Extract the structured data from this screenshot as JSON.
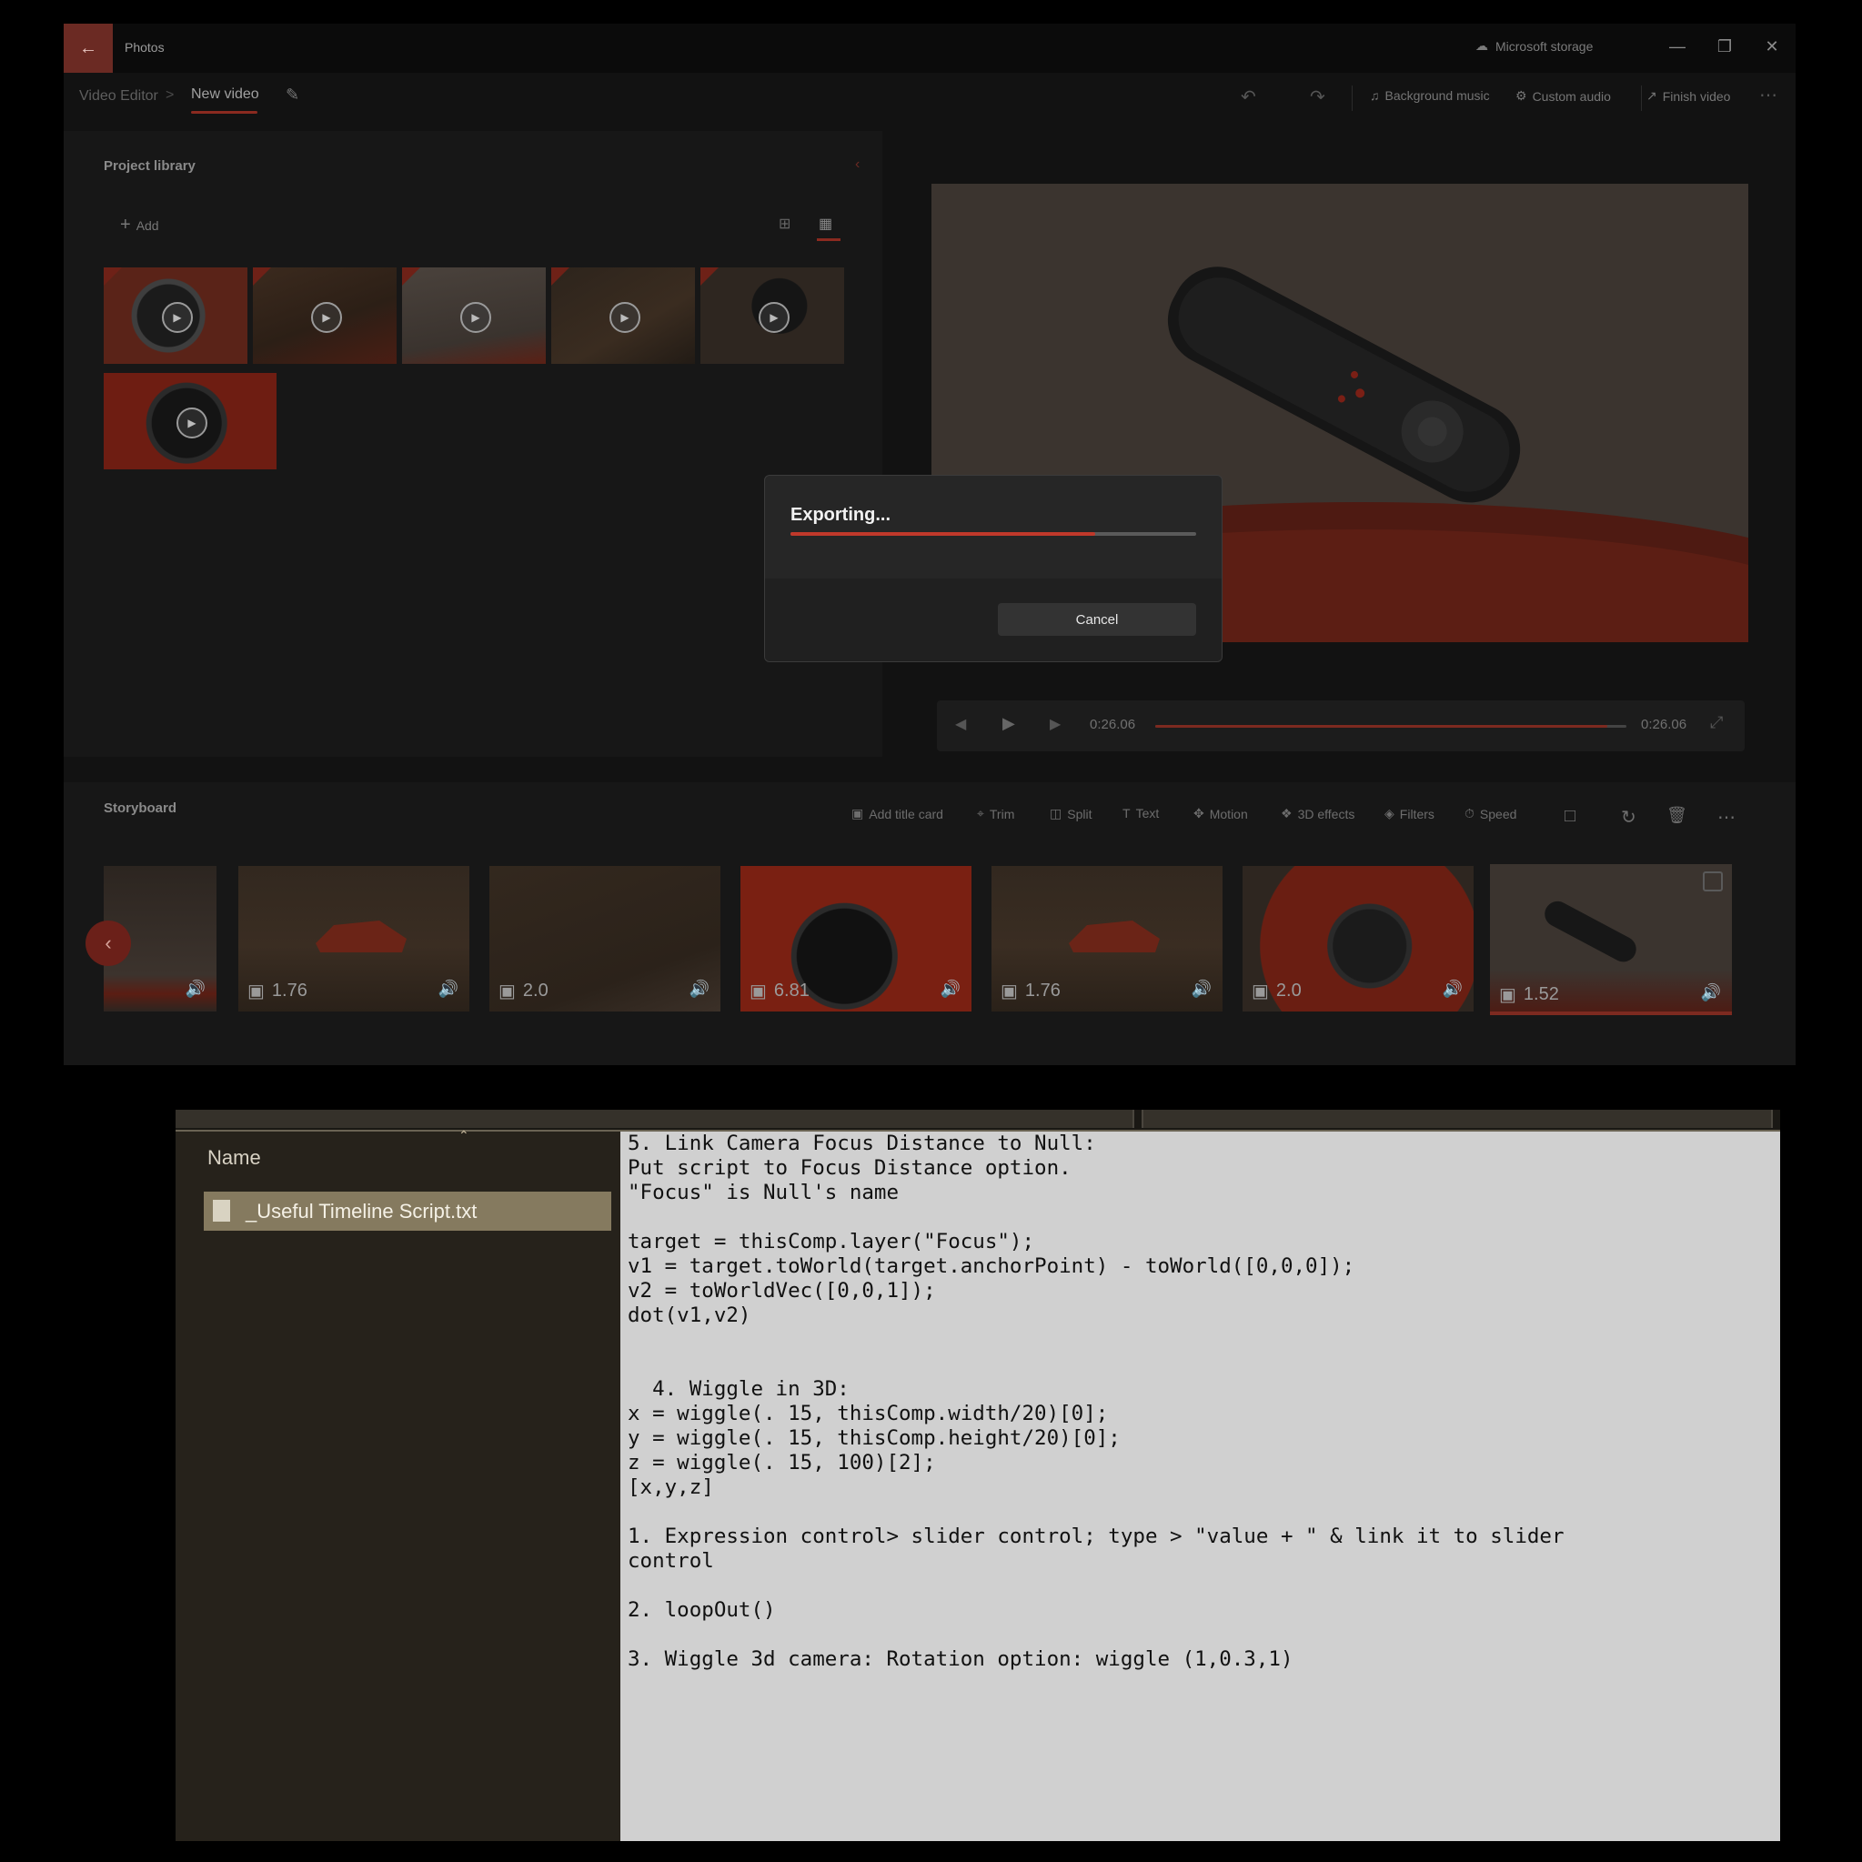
{
  "window": {
    "app_title": "Photos",
    "storage_label": "Microsoft storage",
    "back_icon": "arrow-left-icon",
    "controls": [
      "minimize-icon",
      "restore-icon",
      "close-icon"
    ]
  },
  "toolbar": {
    "breadcrumb_root": "Video Editor",
    "breadcrumb_separator": ">",
    "breadcrumb_current": "New video",
    "background_music": "Background music",
    "custom_audio": "Custom audio",
    "finish_video": "Finish video"
  },
  "library": {
    "title": "Project library",
    "add_label": "Add"
  },
  "player": {
    "current_time": "0:26.06",
    "total_time": "0:26.06",
    "progress": 0.96
  },
  "storyboard": {
    "title": "Storyboard",
    "tools": {
      "add_title_card": "Add title card",
      "trim": "Trim",
      "split": "Split",
      "text": "Text",
      "motion": "Motion",
      "effects_3d": "3D effects",
      "filters": "Filters",
      "speed": "Speed"
    },
    "clips": [
      {
        "duration": ""
      },
      {
        "duration": "1.76"
      },
      {
        "duration": "2.0"
      },
      {
        "duration": "6.81"
      },
      {
        "duration": "1.76"
      },
      {
        "duration": "2.0"
      },
      {
        "duration": "1.52"
      }
    ]
  },
  "dialog": {
    "title": "Exporting...",
    "progress": 0.75,
    "cancel_label": "Cancel"
  },
  "explorer": {
    "column_name": "Name",
    "file_name": "_Useful Timeline Script.txt",
    "script_text": "5. Link Camera Focus Distance to Null:\nPut script to Focus Distance option.\n\"Focus\" is Null's name\n\ntarget = thisComp.layer(\"Focus\");\nv1 = target.toWorld(target.anchorPoint) - toWorld([0,0,0]);\nv2 = toWorldVec([0,0,1]);\ndot(v1,v2)\n\n\n  4. Wiggle in 3D:\nx = wiggle(. 15, thisComp.width/20)[0];\ny = wiggle(. 15, thisComp.height/20)[0];\nz = wiggle(. 15, 100)[2];\n[x,y,z]\n\n1. Expression control> slider control; type > \"value + \" & link it to slider\ncontrol\n\n2. loopOut()\n\n3. Wiggle 3d camera: Rotation option: wiggle (1,0.3,1)"
  }
}
